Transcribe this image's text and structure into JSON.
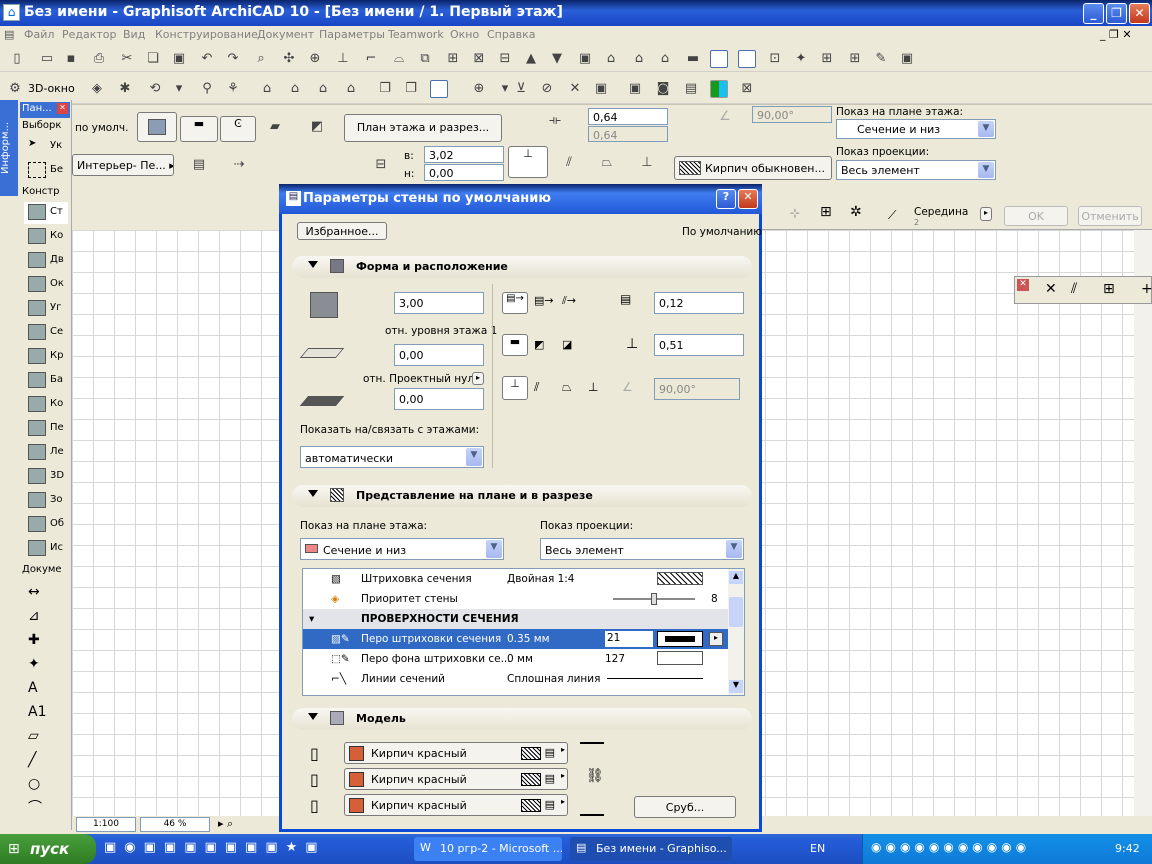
{
  "window": {
    "title": "Без имени - Graphisoft ArchiCAD 10 - [Без имени / 1. Первый этаж]"
  },
  "menu": [
    "Файл",
    "Редактор",
    "Вид",
    "Конструирование",
    "Документ",
    "Параметры",
    "Teamwork",
    "Окно",
    "Справка"
  ],
  "toolbar2": {
    "view3d": "3D-окно"
  },
  "info": {
    "default_label": "по умолч.",
    "plan_section_button": "План этажа и разрез...",
    "height_value": "0,64",
    "height_value2": "0,64",
    "angle_value": "90,00°",
    "floor_show_label": "Показ на плане этажа:",
    "floor_show_value": "Сечение и низ",
    "projection_label": "Показ проекции:",
    "projection_value": "Весь элемент",
    "material_value": "Кирпич обыкновен...",
    "top_label": "в:",
    "top_value": "3,02",
    "bottom_label": "н:",
    "bottom_value": "0,00",
    "layer_value": "Интерьер- Пе..."
  },
  "palette": {
    "title": "Пан...",
    "info_tab": "Информ...",
    "select_header": "Выборк",
    "construct_header": "Констр",
    "document_header": "Докуме",
    "items": [
      "Ук",
      "Бе",
      "Ст",
      "Ко",
      "Дв",
      "Ок",
      "Уг",
      "Се",
      "Кр",
      "Ба",
      "Ко",
      "Пе",
      "Ле",
      "3D",
      "Зо",
      "Об",
      "Ис"
    ]
  },
  "right_panel": {
    "middle_label": "Середина",
    "middle_num": "2",
    "ok": "OK",
    "cancel": "Отменить"
  },
  "dialog": {
    "title": "Параметры стены по умолчанию",
    "favorites": "Избранное...",
    "default_text": "По умолчанию",
    "section1": "Форма и расположение",
    "height": "3,00",
    "rel_floor": "отн. уровня этажа 1",
    "base_offset": "0,00",
    "rel_zero": "отн. Проектный нуль",
    "bottom_val": "0,00",
    "thickness": "0,12",
    "offset": "0,51",
    "angle": "90,00°",
    "show_on_floors_label": "Показать на/связать с этажами:",
    "show_on_floors_value": "автоматически",
    "section2": "Представление на плане и в разрезе",
    "floor_plan_label": "Показ на плане этажа:",
    "floor_plan_value": "Сечение и низ",
    "projection_label": "Показ проекции:",
    "projection_value": "Весь элемент",
    "rows": [
      {
        "name": "Штриховка сечения",
        "value": "Двойная 1:4",
        "extra": ""
      },
      {
        "name": "Приоритет стены",
        "value": "",
        "extra": "8"
      },
      {
        "name": "ПРОВЕРХНОСТИ СЕЧЕНИЯ",
        "value": "",
        "extra": ""
      },
      {
        "name": "Перо штриховки сечения",
        "value": "0.35 мм",
        "extra": "21"
      },
      {
        "name": "Перо фона штриховки се...",
        "value": "0 мм",
        "extra": "127"
      },
      {
        "name": "Линии сечений",
        "value": "Сплошная линия",
        "extra": ""
      }
    ],
    "section3": "Модель",
    "materials": [
      "Кирпич красный",
      "Кирпич красный",
      "Кирпич красный"
    ],
    "log_button": "Сруб..."
  },
  "statusbar": {
    "scale": "1:100",
    "zoom": "46 %"
  },
  "taskbar": {
    "start": "пуск",
    "tasks": [
      "10 ргр-2 - Microsoft ...",
      "Без имени - Graphiso..."
    ],
    "lang": "EN",
    "time": "9:42"
  }
}
